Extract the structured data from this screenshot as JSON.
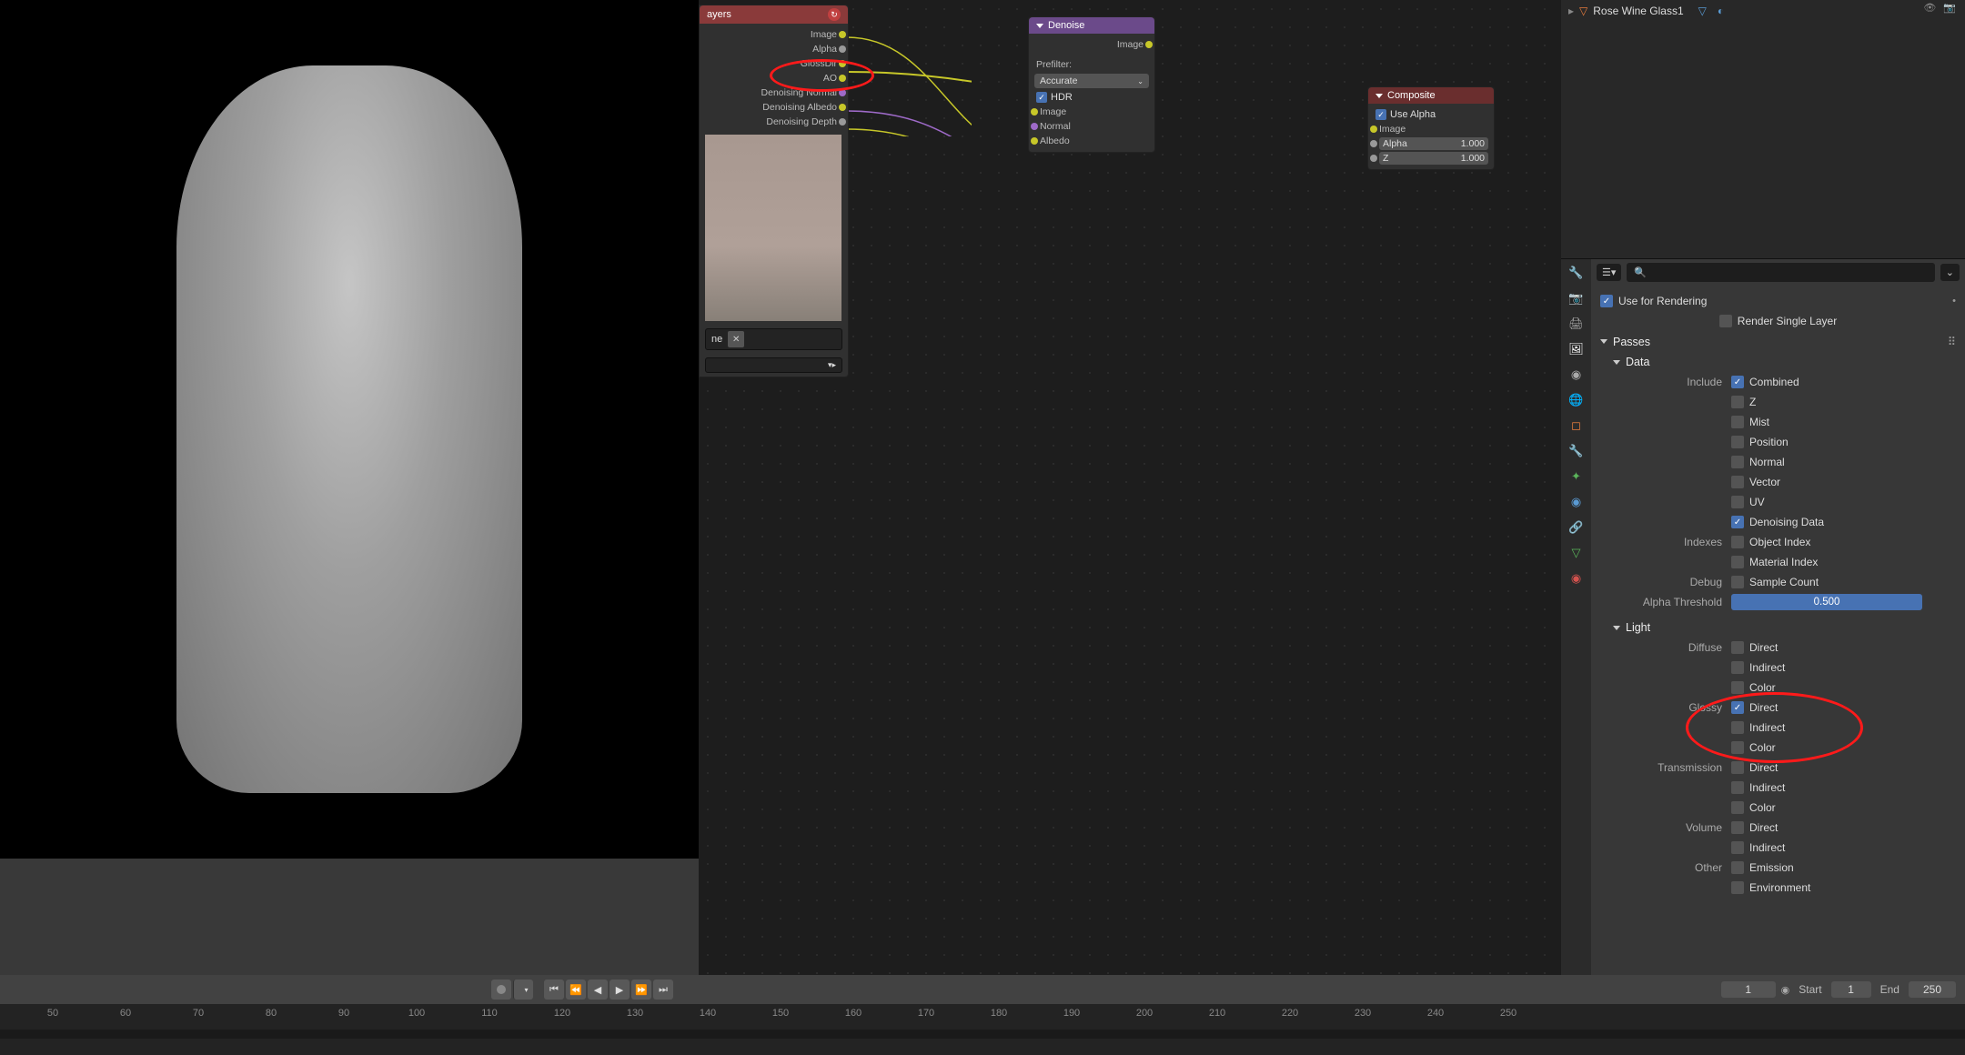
{
  "outliner": {
    "item": "Rose Wine Glass1"
  },
  "search": {
    "placeholder": ""
  },
  "props": {
    "useForRendering": "Use for Rendering",
    "renderSingleLayer": "Render Single Layer",
    "passes": "Passes",
    "dataHeader": "Data",
    "include": "Include",
    "combined": "Combined",
    "z": "Z",
    "mist": "Mist",
    "position": "Position",
    "normal": "Normal",
    "vector": "Vector",
    "uv": "UV",
    "denoisingData": "Denoising Data",
    "indexes": "Indexes",
    "objectIndex": "Object Index",
    "materialIndex": "Material Index",
    "debug": "Debug",
    "sampleCount": "Sample Count",
    "alphaThreshold": "Alpha Threshold",
    "alphaThresholdVal": "0.500",
    "lightHeader": "Light",
    "diffuse": "Diffuse",
    "glossy": "Glossy",
    "transmission": "Transmission",
    "volume": "Volume",
    "other": "Other",
    "direct": "Direct",
    "indirect": "Indirect",
    "color": "Color",
    "emission": "Emission",
    "environment": "Environment"
  },
  "nodes": {
    "layers": {
      "title": "ayers",
      "outputs": [
        "Image",
        "Alpha",
        "GlossDir",
        "AO",
        "Denoising Normal",
        "Denoising Albedo",
        "Denoising Depth"
      ],
      "sceneField": "ne"
    },
    "denoise": {
      "title": "Denoise",
      "outImage": "Image",
      "prefilter": "Prefilter:",
      "prefilterVal": "Accurate",
      "hdr": "HDR",
      "inImage": "Image",
      "inNormal": "Normal",
      "inAlbedo": "Albedo"
    },
    "composite": {
      "title": "Composite",
      "useAlpha": "Use Alpha",
      "image": "Image",
      "alpha": "Alpha",
      "alphaVal": "1.000",
      "z": "Z",
      "zVal": "1.000"
    }
  },
  "timeline": {
    "current": "1",
    "startLabel": "Start",
    "start": "1",
    "endLabel": "End",
    "end": "250",
    "ticks": [
      "50",
      "60",
      "70",
      "80",
      "90",
      "100",
      "110",
      "120",
      "130",
      "140",
      "150",
      "160",
      "170",
      "180",
      "190",
      "200",
      "210",
      "220",
      "230",
      "240",
      "250"
    ]
  }
}
